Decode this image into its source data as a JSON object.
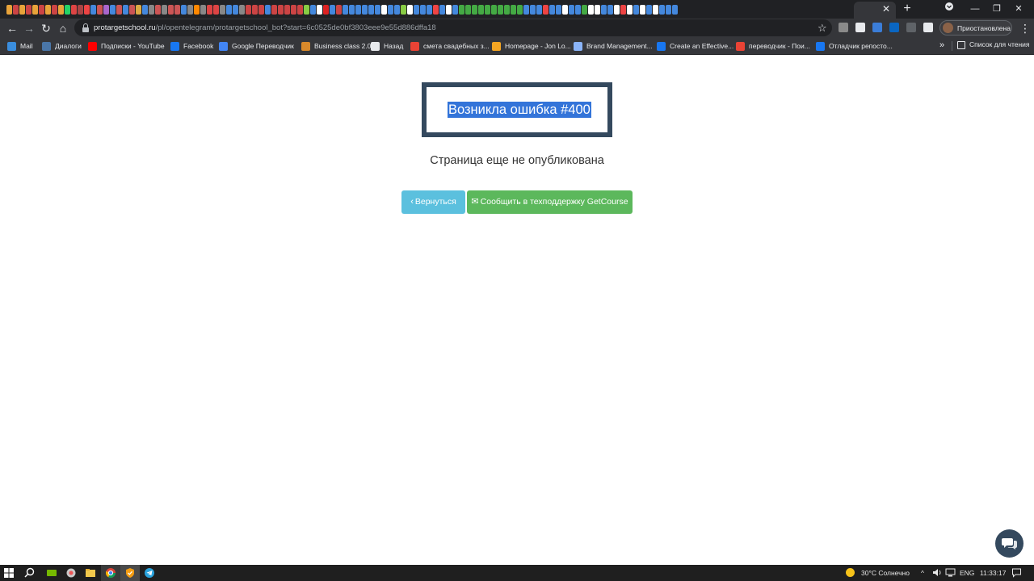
{
  "browser": {
    "tab_strip": {
      "active_tab_close": "✕",
      "new_tab": "+",
      "window_controls": {
        "minimize": "—",
        "restore": "❐",
        "close": "✕"
      },
      "mini_tab_colors": [
        "#e8a33a",
        "#c44",
        "#e8a33a",
        "#c44",
        "#e8a33a",
        "#c44",
        "#e8a33a",
        "#c44",
        "#e8a33a",
        "#25d366",
        "#d44",
        "#a44",
        "#e44",
        "#48d",
        "#c55",
        "#a6c",
        "#48d",
        "#c55",
        "#48d",
        "#c55",
        "#da4",
        "#48d",
        "#888",
        "#c55",
        "#888",
        "#c55",
        "#c55",
        "#48d",
        "#888",
        "#f80",
        "#888",
        "#d44",
        "#d44",
        "#888",
        "#48d",
        "#48d",
        "#888",
        "#c44",
        "#c44",
        "#c44",
        "#48d",
        "#c44",
        "#c44",
        "#c44",
        "#c44",
        "#c44",
        "#8c4",
        "#48d",
        "#fff",
        "#d22",
        "#48d",
        "#c44",
        "#48d",
        "#48d",
        "#48d",
        "#48d",
        "#48d",
        "#48d",
        "#fff",
        "#48d",
        "#48d",
        "#8c4",
        "#fff",
        "#48d",
        "#48d",
        "#48d",
        "#e44",
        "#48d",
        "#fff",
        "#48d",
        "#4a4",
        "#4a4",
        "#4a4",
        "#4a4",
        "#4a4",
        "#4a4",
        "#4a4",
        "#4a4",
        "#4a4",
        "#4a4",
        "#48d",
        "#48d",
        "#48d",
        "#e44",
        "#48d",
        "#48d",
        "#fff",
        "#48d",
        "#48d",
        "#4a4",
        "#fff",
        "#fff",
        "#48d",
        "#48d",
        "#fff",
        "#e44",
        "#fff",
        "#48d",
        "#fff",
        "#48d",
        "#fff",
        "#48d",
        "#48d",
        "#48d"
      ]
    },
    "toolbar": {
      "back": "←",
      "forward": "→",
      "reload": "↻",
      "home": "⌂",
      "url_host": "protargetschool.ru",
      "url_path": "/pl/opentelegram/protargetschool_bot?start=6c0525de0bf3803eee9e55d886dffa18",
      "bookmark_star": "☆",
      "profile_label": "Приостановлена",
      "menu": "⋮",
      "extensions": [
        {
          "name": "ext-1",
          "color": "#8a8a8a"
        },
        {
          "name": "ext-2",
          "color": "#e8eaed"
        },
        {
          "name": "ext-3",
          "color": "#3b7dd8"
        },
        {
          "name": "linkedin",
          "color": "#0a66c2"
        },
        {
          "name": "ext-5",
          "color": "#5f6368"
        },
        {
          "name": "puzzle",
          "color": "#e8eaed"
        }
      ]
    },
    "bookmarks": [
      {
        "label": "Mail",
        "color": "#3a8ddd"
      },
      {
        "label": "Диалоги",
        "color": "#4a76a8"
      },
      {
        "label": "Подписки - YouTube",
        "color": "#ff0000"
      },
      {
        "label": "Facebook",
        "color": "#1877f2"
      },
      {
        "label": "Google Переводчик",
        "color": "#4285f4"
      },
      {
        "label": "Business class 2.0",
        "color": "#d8892b"
      },
      {
        "label": "Назад",
        "color": "#e8eaed"
      },
      {
        "label": "смета свадебных з...",
        "color": "#ea4335"
      },
      {
        "label": "Homepage - Jon Lo...",
        "color": "#f5a623"
      },
      {
        "label": "Brand Management...",
        "color": "#8ab4f8"
      },
      {
        "label": "Create an Effective...",
        "color": "#1877f2"
      },
      {
        "label": "переводчик - Пои...",
        "color": "#ea4335"
      },
      {
        "label": "Отладчик репосто...",
        "color": "#1877f2"
      }
    ],
    "bookmarks_more": "»",
    "reading_list": "Список для чтения"
  },
  "page": {
    "error_title": "Возникла ошибка #400",
    "subtitle": "Страница еще не опубликована",
    "back_button": "Вернуться",
    "back_icon": "‹",
    "support_button": "Сообщить в техподдержку GetCourse",
    "support_icon": "✉"
  },
  "taskbar": {
    "weather": "30°C  Солнечно",
    "tray_arrow": "^",
    "language": "ENG",
    "time": "11:33:17"
  },
  "colors": {
    "error_border": "#34495e",
    "selection": "#3374d9",
    "btn_info": "#5bc0de",
    "btn_success": "#5cb85c"
  }
}
